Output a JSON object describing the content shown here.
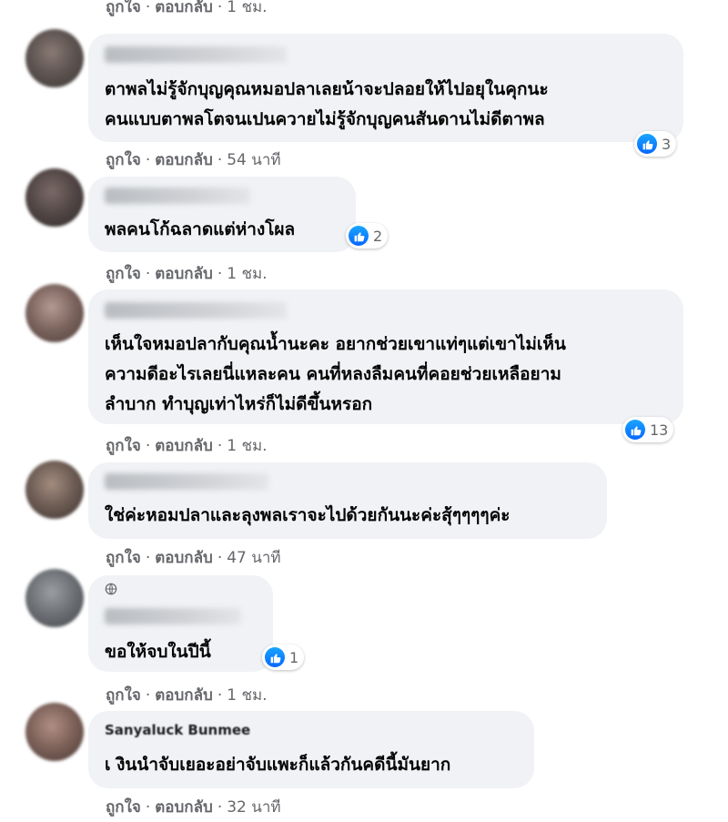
{
  "labels": {
    "like": "ถูกใจ",
    "reply": "ตอบกลับ",
    "separator": "·"
  },
  "top_actions": {
    "time": "1 ชม."
  },
  "comments": [
    {
      "author": "",
      "lines": [
        "ตาพลไม่รู้จักบุญคุณหมอปลาเลยน้าจะปลอยให้ไปอยุในคุกนะ",
        "คนแบบตาพลโตจนเปนควายไม่รู้จักบุญคนสันดานไม่ดีตาพล"
      ],
      "reactions": "3",
      "time": "54 นาที"
    },
    {
      "author": "",
      "lines": [
        "พลคนโก้ฉลาดแต่ห่างโผล"
      ],
      "reactions": "2",
      "time": "1 ชม."
    },
    {
      "author": "",
      "lines": [
        "เห็นใจหมอปลากับคุณน้ำนะคะ อยากช่วยเขาแท่ๆแต่เขาไม่เห็น",
        "ความดีอะไรเลยนี่แหละคน คนที่หลงลืมคนที่คอยช่วยเหลือยาม",
        "ลำบาก ทำบุญเท่าไหร่ก็ไม่ดีขึ้นหรอก"
      ],
      "reactions": "13",
      "time": "1 ชม."
    },
    {
      "author": "",
      "lines": [
        "ใช่ค่ะหอมปลาและลุงพลเราจะไปด้วยกันนะค่ะสุ้ๆๆๆๆค่ะ"
      ],
      "reactions": "",
      "time": "47 นาที"
    },
    {
      "author": "",
      "lines": [
        "ขอให้จบในปีนี้"
      ],
      "reactions": "1",
      "time": "1 ชม."
    },
    {
      "author": "Sanyaluck Bunmee",
      "lines": [
        "เ งินนำจับเยอะอย่าจับแพะก็แล้วกันคดีนี้มันยาก"
      ],
      "reactions": "",
      "time": "32 นาที"
    }
  ],
  "colors": {
    "like_blue": "#0866ff",
    "bubble_bg": "#f0f2f5",
    "meta_text": "#65676b"
  },
  "icons": {
    "reaction": "thumbs-up-icon",
    "group_badge": "globe-icon"
  }
}
